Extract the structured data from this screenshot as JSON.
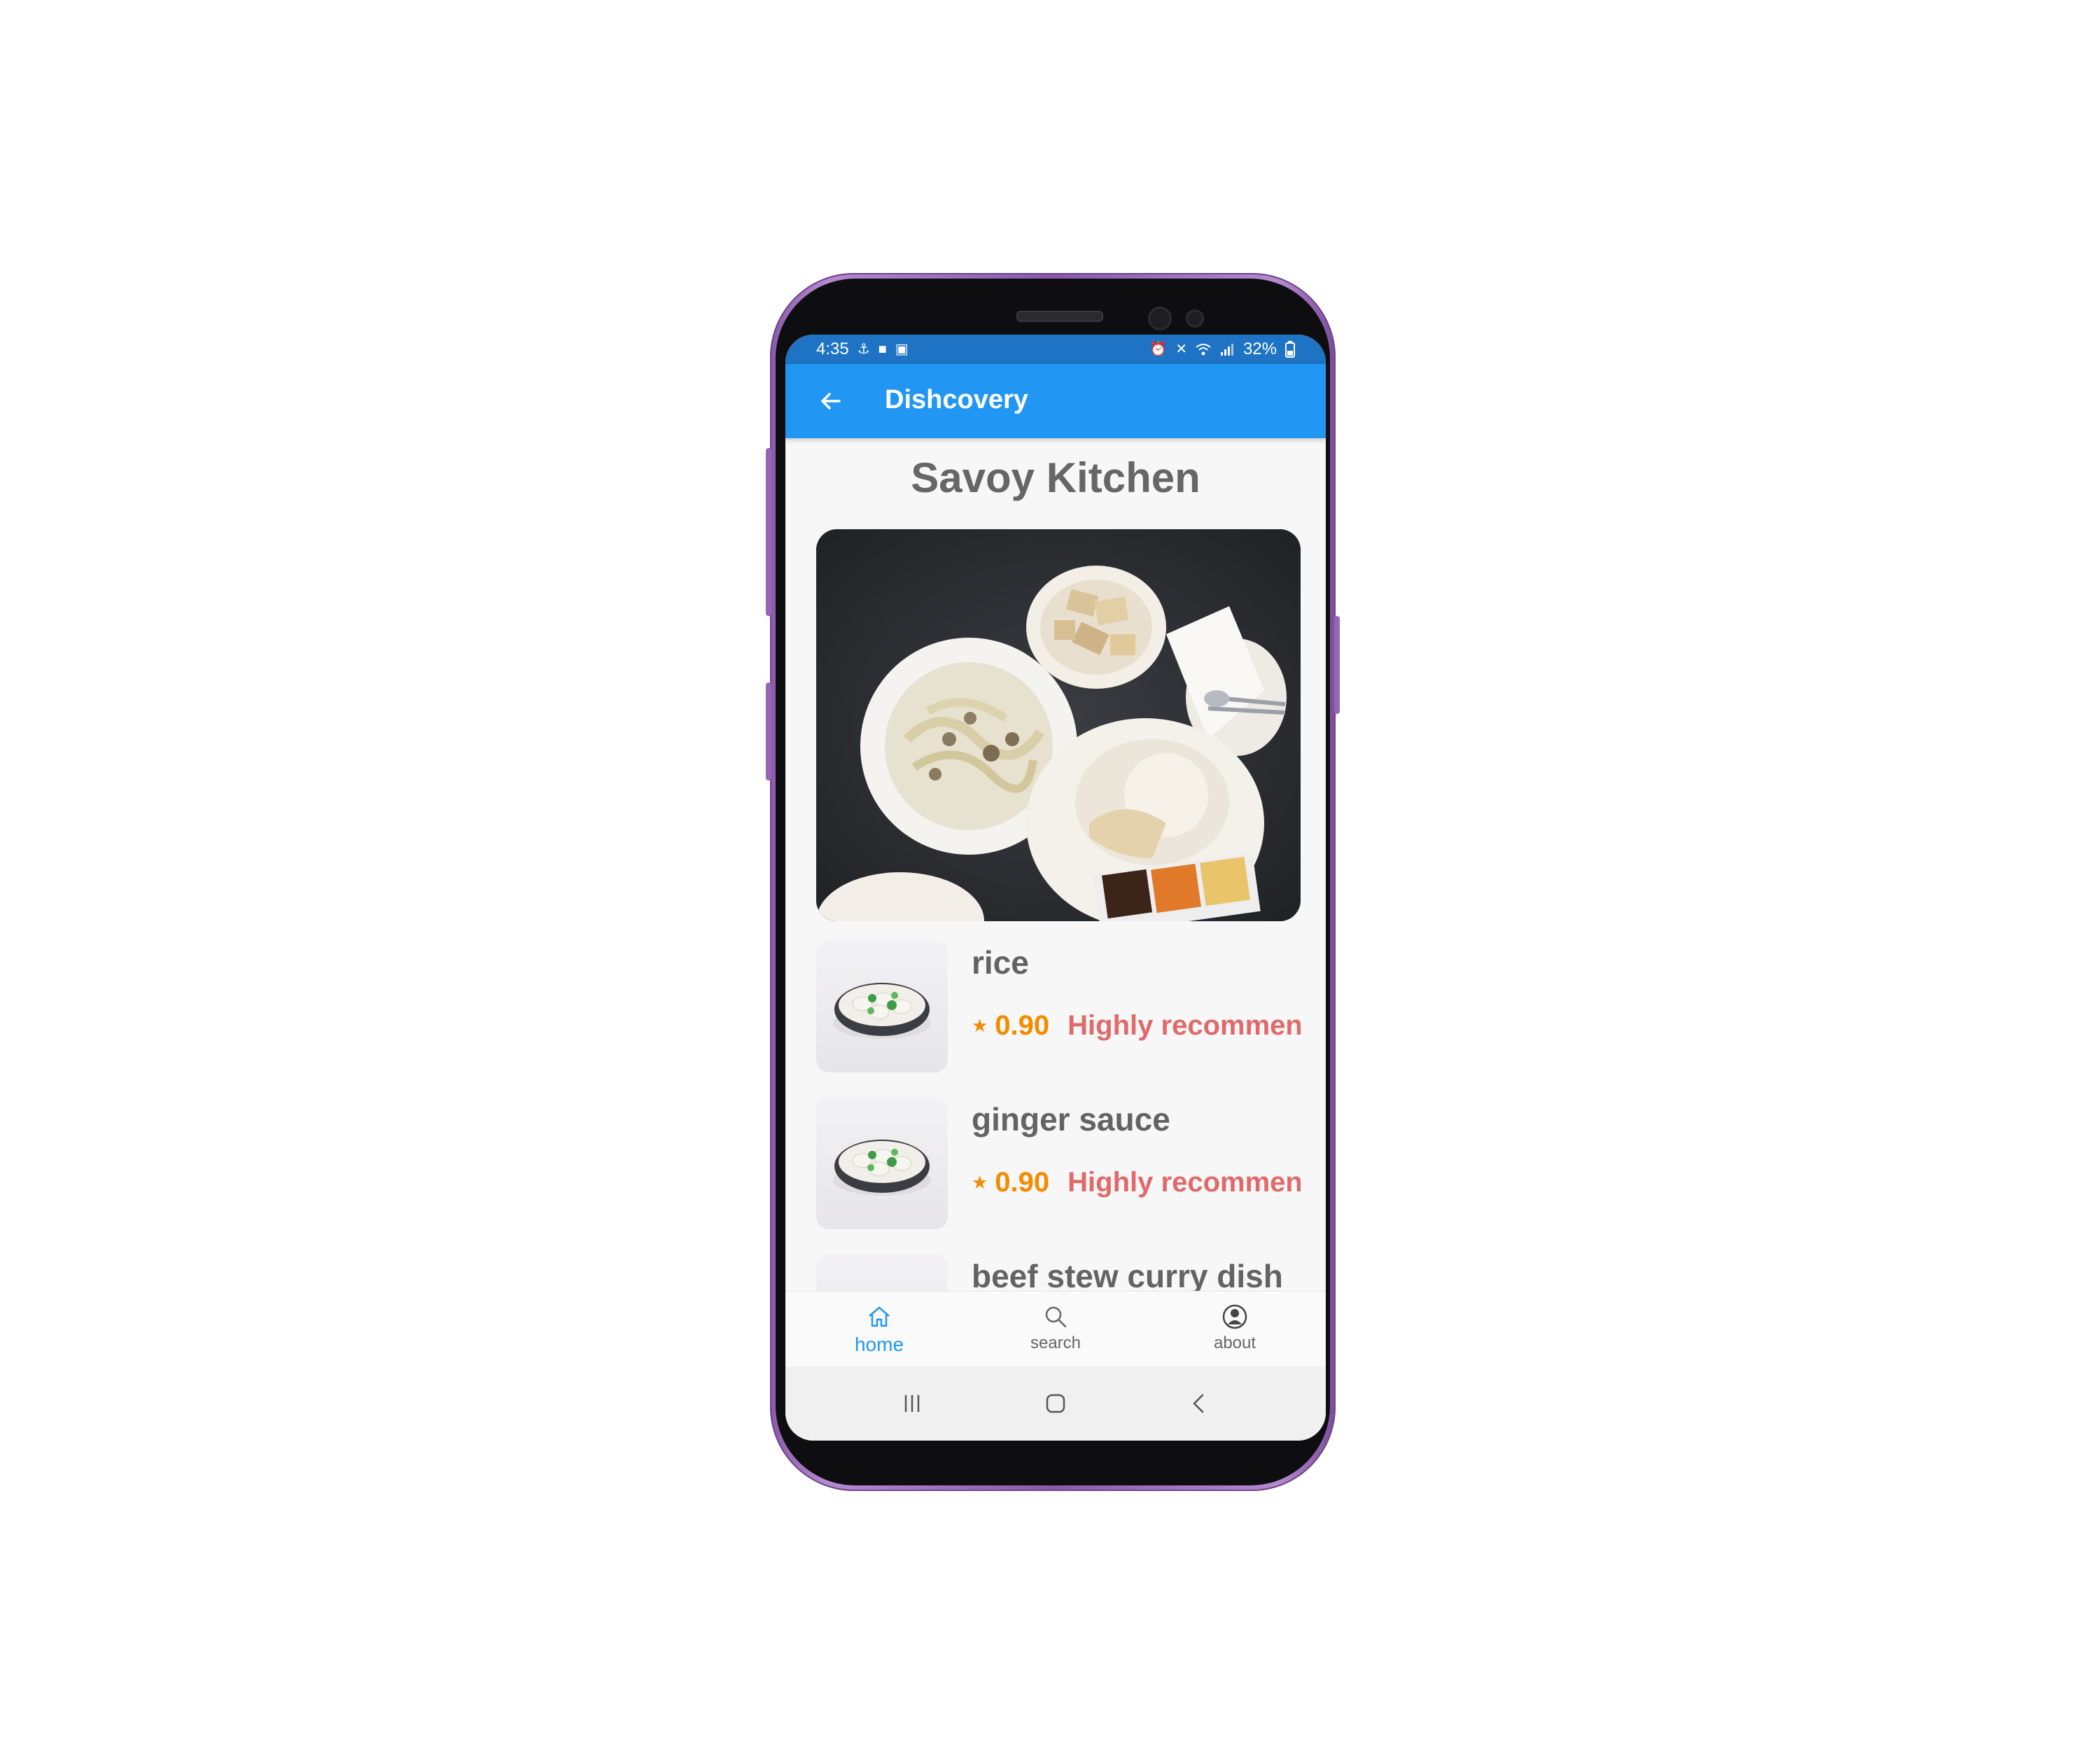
{
  "status_bar": {
    "time": "4:35",
    "battery": "32%",
    "icons_left": [
      "usb-icon",
      "video-icon",
      "image-icon"
    ],
    "icons_right": [
      "alarm-icon",
      "mute-icon",
      "wifi-icon",
      "lte-icon",
      "signal-icon",
      "battery-icon"
    ]
  },
  "app_bar": {
    "title": "Dishcovery",
    "back_icon": "arrow-left-icon"
  },
  "restaurant": {
    "name": "Savoy Kitchen"
  },
  "dishes": [
    {
      "name": "rice",
      "score": "0.90",
      "recommendation": "Highly recommended"
    },
    {
      "name": "ginger sauce",
      "score": "0.90",
      "recommendation": "Highly recommended"
    },
    {
      "name": "beef stew curry dish",
      "score": "",
      "recommendation": ""
    }
  ],
  "bottom_nav": {
    "items": [
      {
        "label": "home",
        "icon": "home-icon",
        "active": true
      },
      {
        "label": "search",
        "icon": "search-icon",
        "active": false
      },
      {
        "label": "about",
        "icon": "user-circle-icon",
        "active": false
      }
    ]
  },
  "colors": {
    "app_bar": "#2196f3",
    "status_bar": "#1e73c4",
    "score": "#f28c00",
    "recommendation": "#e06a6a",
    "text": "#666666",
    "phone": "#8a5aa8"
  }
}
